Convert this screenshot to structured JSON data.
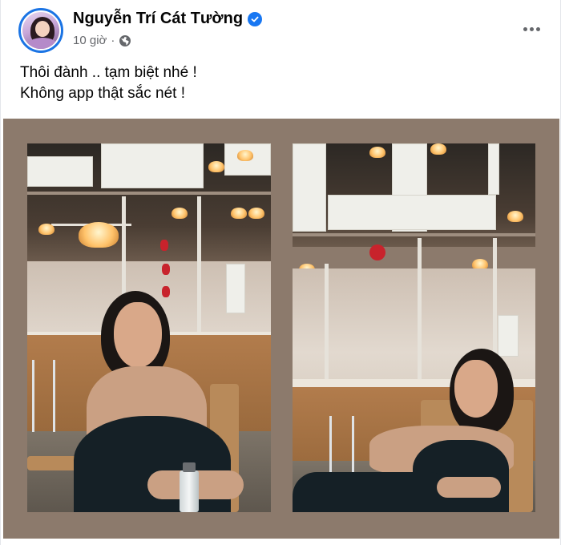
{
  "post": {
    "author": "Nguyễn Trí Cát Tường",
    "time": "10 giờ",
    "separator": "·",
    "audience_icon": "globe-icon",
    "verified_icon": "verified-badge-icon",
    "more_icon": "more-options-icon",
    "caption_lines": [
      "Thôi đành .. tạm biệt nhé !",
      "Không app thật sắc nét !"
    ],
    "photos": [
      {
        "name": "post-photo-left"
      },
      {
        "name": "post-photo-right"
      }
    ]
  },
  "colors": {
    "verified": "#1877f2",
    "avatar_ring": "#1b74e4",
    "meta_text": "#65676b",
    "media_background": "#8c7a6c"
  }
}
